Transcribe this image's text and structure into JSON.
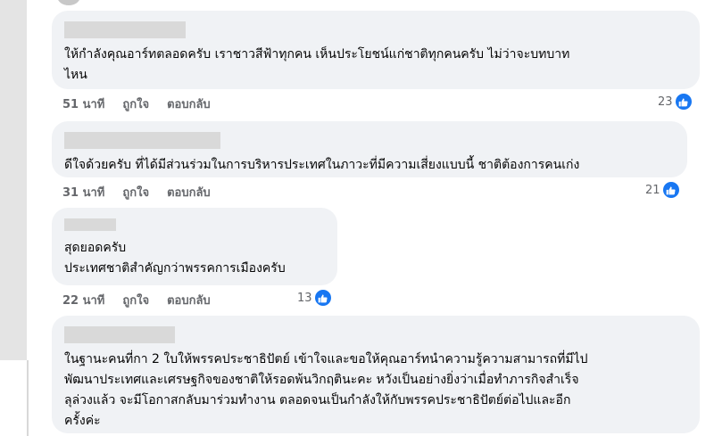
{
  "comments": [
    {
      "text": "ให้กำลังคุณอาร์ทตลอดครับ เราชาวสีฟ้าทุกคน เห็นประโยชน์แก่ชาติทุกคนครับ ไม่ว่าจะบทบาท\nไหน",
      "time": "51 นาที",
      "like": "ถูกใจ",
      "reply": "ตอบกลับ",
      "reactions": "23"
    },
    {
      "text": "ดีใจด้วยครับ ที่ได้มีส่วนร่วมในการบริหารประเทศในภาวะที่มีความเสี่ยงแบบนี้ ชาติต้องการคนเก่ง",
      "time": "31 นาที",
      "like": "ถูกใจ",
      "reply": "ตอบกลับ",
      "reactions": "21"
    },
    {
      "text": "สุดยอดครับ\nประเทศชาติสำคัญกว่าพรรคการเมืองครับ",
      "time": "22 นาที",
      "like": "ถูกใจ",
      "reply": "ตอบกลับ",
      "reactions": "13"
    },
    {
      "text": "ในฐานะคนที่กา 2 ใบให้พรรคประชาธิปัตย์ เข้าใจและขอให้คุณอาร์ทนำความรู้ความสามารถที่มีไป\nพัฒนาประเทศและเศรษฐกิจของชาติให้รอดพ้นวิกฤตินะคะ หวังเป็นอย่างยิ่งว่าเมื่อทำภารกิจสำเร็จ\nลุล่วงแล้ว จะมีโอกาสกลับมาร่วมทำงาน ตลอดจนเป็นกำลังให้กับพรรคประชาธิปัตย์ต่อไปและอีก\nครั้งค่ะ"
    }
  ],
  "colors": {
    "bubble": "#f0f2f5",
    "like_blue": "#1877f2",
    "meta_gray": "#65676b"
  },
  "icons": {
    "reaction": "thumbs-up-icon"
  }
}
